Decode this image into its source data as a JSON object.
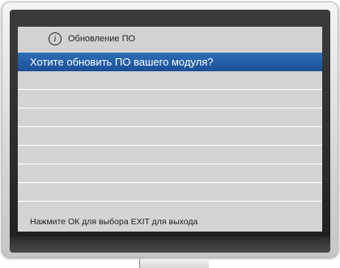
{
  "dialog": {
    "icon": "info-icon",
    "icon_glyph": "i",
    "title": "Обновление ПО",
    "question": "Хотите обновить ПО вашего модуля?",
    "footer_hint": "Нажмите ОК для выбора EXIT для выхода"
  },
  "colors": {
    "highlight_bar": "#1f58a3",
    "screen_background": "#d4d4d4",
    "bezel": "#e0e0e0",
    "frame": "#2f2f2f"
  }
}
